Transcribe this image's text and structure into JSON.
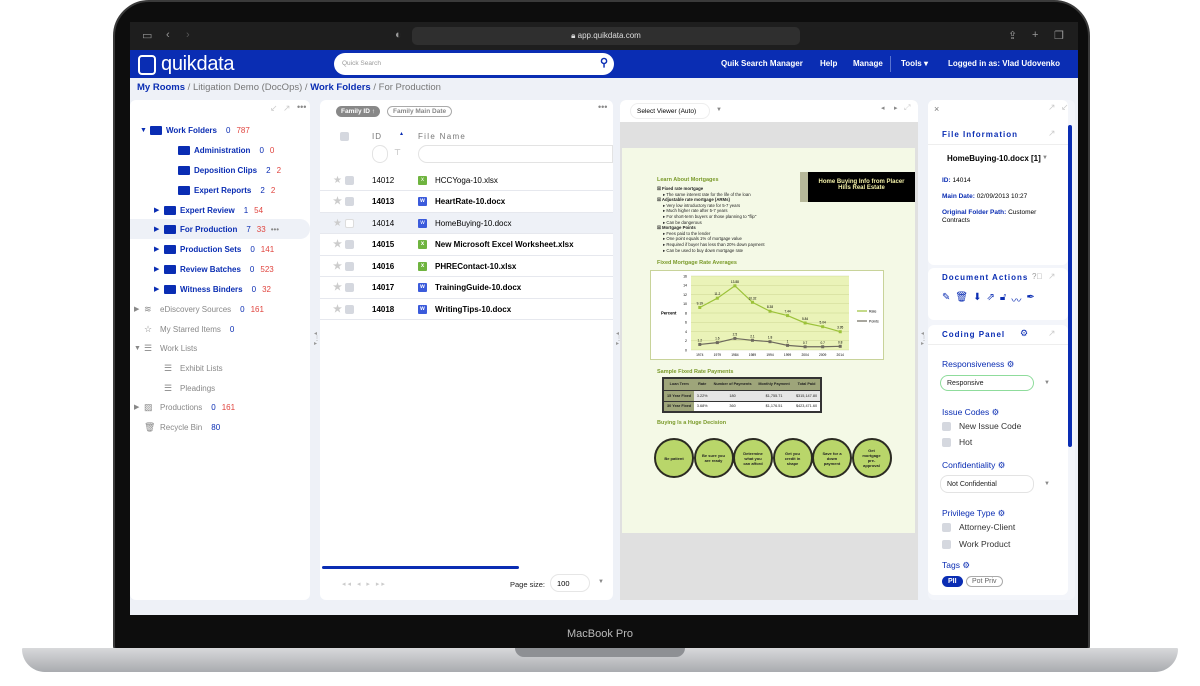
{
  "device": {
    "label": "MacBook Pro"
  },
  "browser": {
    "url": "app.quikdata.com"
  },
  "app": {
    "logo": "quikdata",
    "search_placeholder": "Quick Search",
    "nav": [
      "Quik Search Manager",
      "Help",
      "Manage",
      "Tools",
      "Logged in as: Vlad Udovenko"
    ],
    "brand_color": "#0a2db3"
  },
  "breadcrumb": [
    "My Rooms",
    "Litigation Demo (DocOps)",
    "Work Folders",
    "For Production"
  ],
  "tree": {
    "items": [
      {
        "label": "Work Folders",
        "a": "0",
        "b": "787"
      },
      {
        "label": "Administration",
        "a": "0",
        "b": "0"
      },
      {
        "label": "Deposition Clips",
        "a": "2",
        "b": "2"
      },
      {
        "label": "Expert Reports",
        "a": "2",
        "b": "2"
      },
      {
        "label": "Expert Review",
        "a": "1",
        "b": "54"
      },
      {
        "label": "For Production",
        "a": "7",
        "b": "33"
      },
      {
        "label": "Production Sets",
        "a": "0",
        "b": "141"
      },
      {
        "label": "Review Batches",
        "a": "0",
        "b": "523"
      },
      {
        "label": "Witness Binders",
        "a": "0",
        "b": "32"
      },
      {
        "label": "eDiscovery Sources",
        "a": "0",
        "b": "161"
      },
      {
        "label": "My Starred Items",
        "a": "0"
      },
      {
        "label": "Work Lists"
      },
      {
        "label": "Exhibit Lists"
      },
      {
        "label": "Pleadings"
      },
      {
        "label": "Productions",
        "a": "0",
        "b": "161"
      },
      {
        "label": "Recycle Bin",
        "a": "80"
      }
    ]
  },
  "list": {
    "sort_chips": [
      "Family ID ↑",
      "Family Main Date"
    ],
    "col_id": "ID",
    "col_name": "File Name",
    "rows": [
      {
        "id": "14012",
        "name": "HCCYoga-10.xlsx",
        "type": "x",
        "bold": false
      },
      {
        "id": "14013",
        "name": "HeartRate-10.docx",
        "type": "w",
        "bold": true
      },
      {
        "id": "14014",
        "name": "HomeBuying-10.docx",
        "type": "w",
        "bold": false,
        "selected": true
      },
      {
        "id": "14015",
        "name": "New Microsoft Excel Worksheet.xlsx",
        "type": "x",
        "bold": true
      },
      {
        "id": "14016",
        "name": "PHREContact-10.xlsx",
        "type": "x",
        "bold": true
      },
      {
        "id": "14017",
        "name": "TrainingGuide-10.docx",
        "type": "w",
        "bold": true
      },
      {
        "id": "14018",
        "name": "WritingTips-10.docx",
        "type": "w",
        "bold": true
      }
    ],
    "page_size_label": "Page size:",
    "page_size": "100"
  },
  "viewer": {
    "select": "Select Viewer (Auto)",
    "doc": {
      "h1": "Learn About Mortgages",
      "banner": "Home Buying Info from Placer Hills Real Estate",
      "bullets": [
        {
          "t": "Fixed rate mortgage",
          "sub": [
            "The same interest rate for the life of the loan"
          ]
        },
        {
          "t": "Adjustable rate mortgage (ARMs)",
          "sub": [
            "Very low introductory rate for 5-7 years",
            "Much higher rate after 5-7 years",
            "For short-term buyers or those planning to \"flip\"",
            "Can be dangerous"
          ]
        },
        {
          "t": "Mortgage Points",
          "sub": [
            "Fees paid to the lender",
            "One point equals 1% of mortgage value",
            "Required if buyer has less than 20% down payment",
            "Can be used to buy down mortgage rate"
          ]
        }
      ],
      "h2": "Fixed Mortgage Rate Averages",
      "chart": {
        "type": "line",
        "ylabel": "Percent",
        "ylim": [
          0,
          16
        ],
        "yticks": [
          0,
          2,
          4,
          6,
          8,
          10,
          12,
          14,
          16
        ],
        "categories": [
          "1974",
          "1979",
          "1984",
          "1989",
          "1994",
          "1999",
          "2004",
          "2009",
          "2014"
        ],
        "series": [
          {
            "name": "Rate",
            "values": [
              9.19,
              11.2,
              13.88,
              10.32,
              8.38,
              7.44,
              5.84,
              5.04,
              3.95
            ],
            "color": "#9cc23a"
          },
          {
            "name": "Points",
            "values": [
              1.2,
              1.6,
              2.5,
              2.1,
              1.8,
              1,
              0.7,
              0.7,
              0.8
            ],
            "color": "#6e6a5e"
          }
        ],
        "legend": "right"
      },
      "h3": "Sample Fixed Rate Payments",
      "table": {
        "head": [
          "Loan Term",
          "Rate",
          "Number of Payments",
          "Monthly Payment",
          "Total Paid"
        ],
        "rows": [
          [
            "15 Year Fixed",
            "3.22%",
            "180",
            "$1,755.71",
            "$315,147.80"
          ],
          [
            "30 Year Fixed",
            "3.68%",
            "360",
            "$1,176.51",
            "$423,471.60"
          ]
        ]
      },
      "h4": "Buying Is a Huge Decision",
      "steps": [
        "Be patient",
        "Be sure you are ready",
        "Determine what you can afford",
        "Get you credit in shape",
        "Save for a down payment",
        "Get mortgage pre-approval"
      ]
    }
  },
  "right": {
    "file_info_title": "File Information",
    "file_name": "HomeBuying-10.docx [1]",
    "id_label": "ID:",
    "id": "14014",
    "date_label": "Main Date:",
    "date": "02/09/2013 10:27",
    "path_label": "Original Folder Path:",
    "path": "Customer Contracts",
    "actions_title": "Document Actions",
    "coding_title": "Coding Panel",
    "responsiveness_label": "Responsiveness",
    "responsiveness": "Responsive",
    "issue_label": "Issue Codes",
    "issues": [
      "New Issue Code",
      "Hot"
    ],
    "conf_label": "Confidentiality",
    "conf": "Not Confidential",
    "priv_label": "Privilege Type",
    "privs": [
      "Attorney-Client",
      "Work Product"
    ],
    "tags_label": "Tags",
    "tags": [
      "PII",
      "Pot Priv"
    ]
  }
}
